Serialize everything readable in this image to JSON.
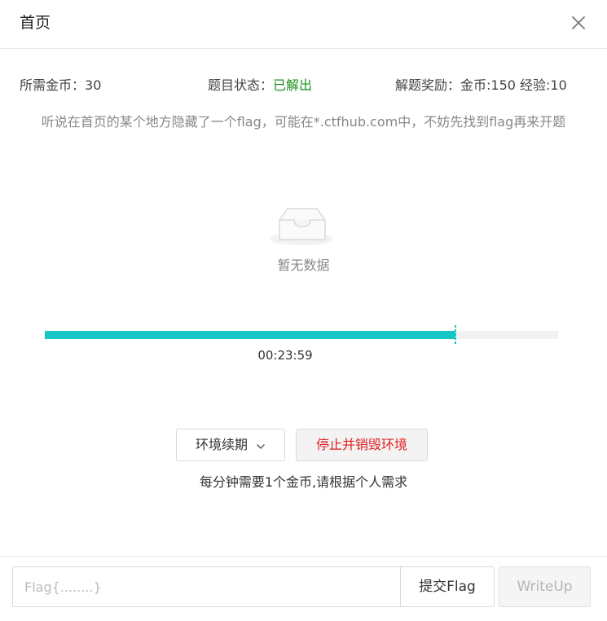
{
  "header": {
    "title": "首页",
    "close_icon": "close-icon"
  },
  "info": {
    "cost_label": "所需金币：",
    "cost_value": "30",
    "status_label": "题目状态：",
    "status_value": "已解出",
    "reward_label": "解题奖励：",
    "reward_value": "金币:150 经验:10"
  },
  "description": "听说在首页的某个地方隐藏了一个flag，可能在*.ctfhub.com中，不妨先找到flag再来开题",
  "empty": {
    "icon": "empty-inbox-icon",
    "text": "暂无数据"
  },
  "progress": {
    "fraction": 0.8,
    "timer": "00:23:59"
  },
  "actions": {
    "renew_label": "环境续期",
    "renew_icon": "chevron-down-icon",
    "stop_label": "停止并销毁环境",
    "hint": "每分钟需要1个金币,请根据个人需求"
  },
  "footer": {
    "flag_placeholder": "Flag{........}",
    "flag_value": "",
    "submit_label": "提交Flag",
    "writeup_label": "WriteUp"
  },
  "colors": {
    "accent": "#16c5c5",
    "solved": "#1b8f1b",
    "danger": "#e02020"
  }
}
